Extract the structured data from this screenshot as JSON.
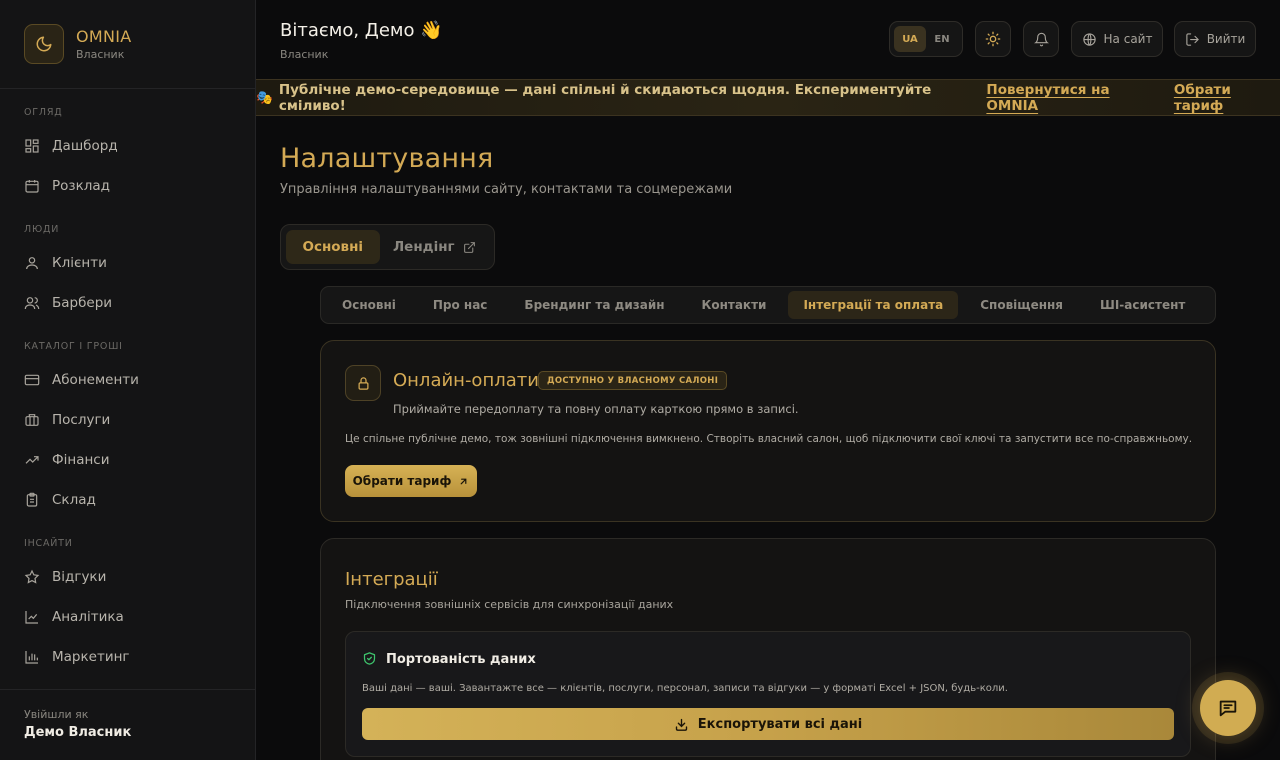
{
  "brand": {
    "name": "OMNIA",
    "role": "Власник"
  },
  "sidebar": {
    "sections": [
      {
        "title": "ОГЛЯД",
        "items": [
          {
            "label": "Дашборд",
            "icon": "dashboard-icon"
          },
          {
            "label": "Розклад",
            "icon": "calendar-icon"
          }
        ]
      },
      {
        "title": "ЛЮДИ",
        "items": [
          {
            "label": "Клієнти",
            "icon": "user-icon"
          },
          {
            "label": "Барбери",
            "icon": "users-icon"
          }
        ]
      },
      {
        "title": "КАТАЛОГ І ГРОШІ",
        "items": [
          {
            "label": "Абонементи",
            "icon": "card-icon"
          },
          {
            "label": "Послуги",
            "icon": "briefcase-icon"
          },
          {
            "label": "Фінанси",
            "icon": "trend-icon"
          },
          {
            "label": "Склад",
            "icon": "clipboard-icon"
          }
        ]
      },
      {
        "title": "ІНСАЙТИ",
        "items": [
          {
            "label": "Відгуки",
            "icon": "star-icon"
          },
          {
            "label": "Аналітика",
            "icon": "line-chart-icon"
          },
          {
            "label": "Маркетинг",
            "icon": "bar-chart-icon"
          }
        ]
      }
    ],
    "footer": {
      "label": "Увійшли як",
      "user": "Демо Власник"
    }
  },
  "header": {
    "greeting": "Вітаємо, Демо",
    "greeting_emoji": "👋",
    "role": "Власник",
    "lang": {
      "active": "UA",
      "other": "EN"
    },
    "site_label": "На сайт",
    "logout_label": "Вийти"
  },
  "banner": {
    "emoji": "🎭",
    "text": "Публічне демо-середовище — дані спільні й скидаються щодня. Експериментуйте сміливо!",
    "link_back": "Повернутися на OMNIA",
    "link_plan": "Обрати тариф"
  },
  "page": {
    "title": "Налаштування",
    "subtitle": "Управління налаштуваннями сайту, контактами та соцмережами",
    "top_tabs": {
      "main": "Основні",
      "landing": "Лендінг"
    },
    "sub_tabs": [
      "Основні",
      "Про нас",
      "Брендинг та дизайн",
      "Контакти",
      "Інтеграції та оплата",
      "Сповіщення",
      "ШІ-асистент"
    ],
    "active_sub_tab": "Інтеграції та оплата"
  },
  "payments_card": {
    "title": "Онлайн-оплати",
    "badge": "ДОСТУПНО У ВЛАСНОМУ САЛОНІ",
    "description": "Приймайте передоплату та повну оплату карткою прямо в записі.",
    "note": "Це спільне публічне демо, тож зовнішні підключення вимкнено. Створіть власний салон, щоб підключити свої ключі та запустити все по-справжньому.",
    "button": "Обрати тариф"
  },
  "integrations_card": {
    "title": "Інтеграції",
    "description": "Підключення зовнішніх сервісів для синхронізації даних",
    "portability": {
      "title": "Портованість даних",
      "description": "Ваші дані — ваші. Завантажте все — клієнтів, послуги, персонал, записи та відгуки — у форматі Excel + JSON, будь-коли.",
      "button": "Експортувати всі дані"
    }
  },
  "colors": {
    "accent": "#d4aa55",
    "background": "#0b0b0c",
    "panel": "#141415"
  }
}
